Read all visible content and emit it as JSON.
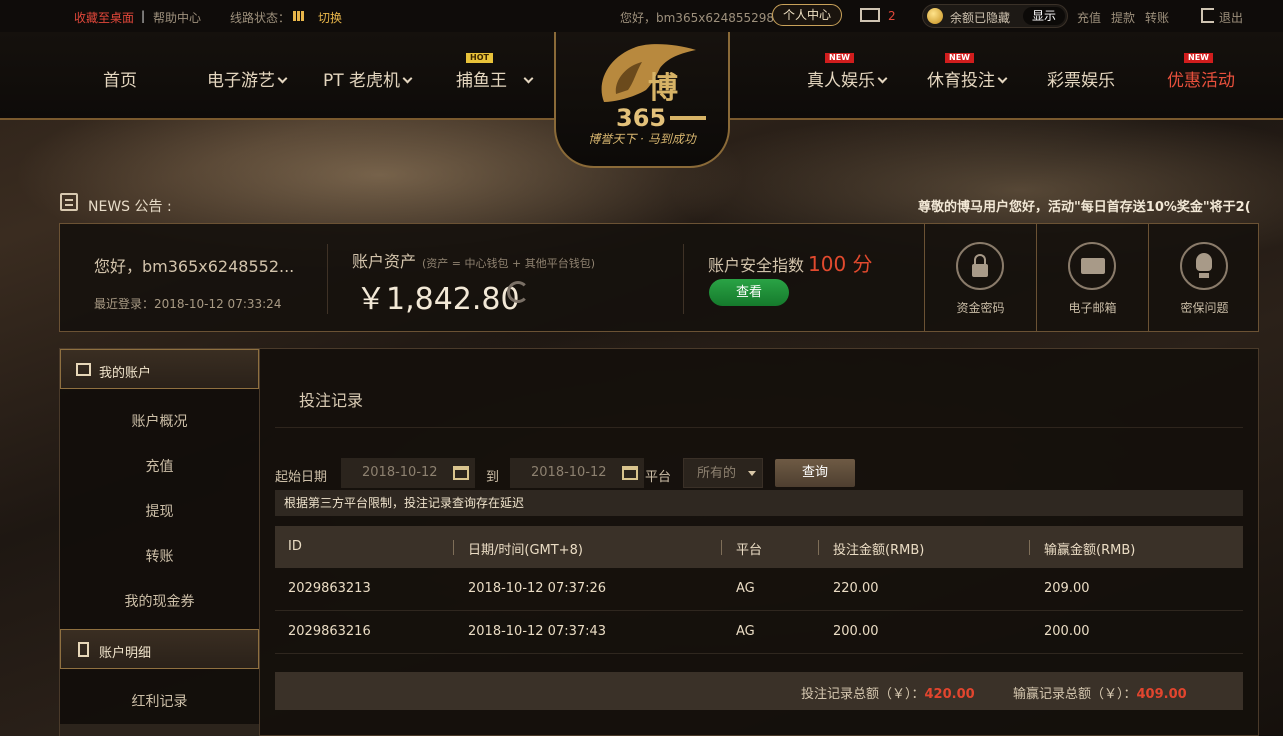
{
  "topbar": {
    "bookmark": "收藏至桌面",
    "help": "帮助中心",
    "line_status": "线路状态：",
    "switch": "切换",
    "greeting": "您好，bm365x624855298",
    "personal_center": "个人中心",
    "mail_count": "2",
    "balance_hidden": "余额已隐藏",
    "show": "显示",
    "deposit": "充值",
    "withdraw": "提款",
    "transfer": "转账",
    "logout": "退出"
  },
  "nav": {
    "home": "首页",
    "slots": "电子游艺",
    "pt": "PT 老虎机",
    "fishing": "捕鱼王",
    "live": "真人娱乐",
    "sports": "休育投注",
    "lottery": "彩票娱乐",
    "promo": "优惠活动",
    "badge_hot": "HOT",
    "badge_new": "NEW"
  },
  "logo": {
    "brand": "博马365",
    "slogan": "博誉天下 · 马到成功"
  },
  "news": {
    "label": "NEWS 公告 :",
    "text": "尊敬的博马用户您好，活动\"每日首存送10%奖金\"将于2("
  },
  "account": {
    "hello": "您好，bm365x6248552...",
    "last_login": "最近登录：2018-10-12 07:33:24",
    "asset_title": "账户资产",
    "asset_note": "(资产 = 中心钱包 + 其他平台钱包)",
    "balance": "￥1,842.80",
    "security_title": "账户安全指数",
    "security_score": "100 分",
    "view": "查看",
    "fund_password": "资金密码",
    "email": "电子邮箱",
    "security_question": "密保问题"
  },
  "sidebar": {
    "my_account": "我的账户",
    "items": [
      "账户概况",
      "充值",
      "提现",
      "转账",
      "我的现金券"
    ],
    "account_detail": "账户明细",
    "detail_items": [
      "红利记录"
    ]
  },
  "main": {
    "title": "投注记录",
    "start_label": "起始日期",
    "start_date": "2018-10-12",
    "to_label": "到",
    "end_date": "2018-10-12",
    "platform_label": "平台",
    "platform_value": "所有的",
    "query": "查询",
    "notice": "根据第三方平台限制，投注记录查询存在延迟",
    "columns": [
      "ID",
      "日期/时间(GMT+8)",
      "平台",
      "投注金额(RMB)",
      "输赢金额(RMB)"
    ],
    "rows": [
      [
        "2029863213",
        "2018-10-12 07:37:26",
        "AG",
        "220.00",
        "209.00"
      ],
      [
        "2029863216",
        "2018-10-12 07:37:43",
        "AG",
        "200.00",
        "200.00"
      ]
    ],
    "total_bet_label": "投注记录总额（￥）：",
    "total_bet": "420.00",
    "total_win_label": "输赢记录总额（￥）：",
    "total_win": "409.00"
  }
}
